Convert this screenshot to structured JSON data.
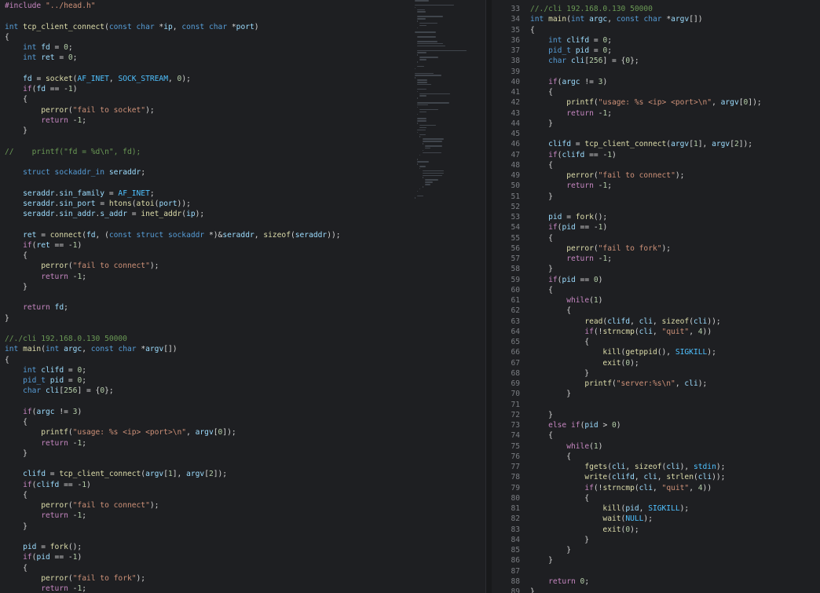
{
  "left_lines": [
    "#include \"../head.h\"",
    "",
    "int tcp_client_connect(const char *ip, const char *port)",
    "{",
    "    int fd = 0;",
    "    int ret = 0;",
    "",
    "    fd = socket(AF_INET, SOCK_STREAM, 0);",
    "    if(fd == -1)",
    "    {",
    "        perror(\"fail to socket\");",
    "        return -1;",
    "    }",
    "",
    "//    printf(\"fd = %d\\n\", fd);",
    "",
    "    struct sockaddr_in seraddr;",
    "",
    "    seraddr.sin_family = AF_INET;",
    "    seraddr.sin_port = htons(atoi(port));",
    "    seraddr.sin_addr.s_addr = inet_addr(ip);",
    "",
    "    ret = connect(fd, (const struct sockaddr *)&seraddr, sizeof(seraddr));",
    "    if(ret == -1)",
    "    {",
    "        perror(\"fail to connect\");",
    "        return -1;",
    "    }",
    "",
    "    return fd;",
    "}",
    "",
    "//./cli 192.168.0.130 50000",
    "int main(int argc, const char *argv[])",
    "{",
    "    int clifd = 0;",
    "    pid_t pid = 0;",
    "    char cli[256] = {0};",
    "",
    "    if(argc != 3)",
    "    {",
    "        printf(\"usage: %s <ip> <port>\\n\", argv[0]);",
    "        return -1;",
    "    }",
    "",
    "    clifd = tcp_client_connect(argv[1], argv[2]);",
    "    if(clifd == -1)",
    "    {",
    "        perror(\"fail to connect\");",
    "        return -1;",
    "    }",
    "",
    "    pid = fork();",
    "    if(pid == -1)",
    "    {",
    "        perror(\"fail to fork\");",
    "        return -1;"
  ],
  "right_start": 33,
  "right_lines": [
    "//./cli 192.168.0.130 50000",
    "int main(int argc, const char *argv[])",
    "{",
    "    int clifd = 0;",
    "    pid_t pid = 0;",
    "    char cli[256] = {0};",
    "",
    "    if(argc != 3)",
    "    {",
    "        printf(\"usage: %s <ip> <port>\\n\", argv[0]);",
    "        return -1;",
    "    }",
    "",
    "    clifd = tcp_client_connect(argv[1], argv[2]);",
    "    if(clifd == -1)",
    "    {",
    "        perror(\"fail to connect\");",
    "        return -1;",
    "    }",
    "",
    "    pid = fork();",
    "    if(pid == -1)",
    "    {",
    "        perror(\"fail to fork\");",
    "        return -1;",
    "    }",
    "    if(pid == 0)",
    "    {",
    "        while(1)",
    "        {",
    "            read(clifd, cli, sizeof(cli));",
    "            if(!strncmp(cli, \"quit\", 4))",
    "            {",
    "                kill(getppid(), SIGKILL);",
    "                exit(0);",
    "            }",
    "            printf(\"server:%s\\n\", cli);",
    "        }",
    "",
    "    }",
    "    else if(pid > 0)",
    "    {",
    "        while(1)",
    "        {",
    "            fgets(cli, sizeof(cli), stdin);",
    "            write(clifd, cli, strlen(cli));",
    "            if(!strncmp(cli, \"quit\", 4))",
    "            {",
    "                kill(pid, SIGKILL);",
    "                wait(NULL);",
    "                exit(0);",
    "            }",
    "        }",
    "    }",
    "",
    "    return 0;",
    "}"
  ]
}
